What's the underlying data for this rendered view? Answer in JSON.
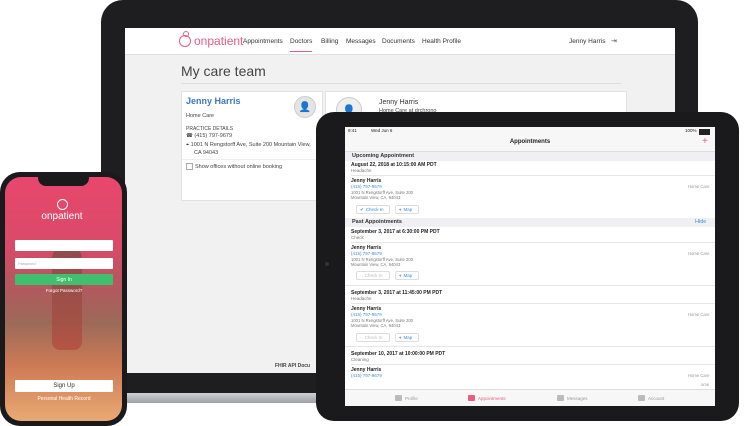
{
  "brand": {
    "name": "onpatient",
    "color": "#e95d83"
  },
  "laptop": {
    "nav": {
      "links": [
        "Appointments",
        "Doctors",
        "Billing",
        "Messages",
        "Documents",
        "Health Profile"
      ],
      "active": "Doctors",
      "user": "Jenny Harris"
    },
    "page_title": "My care team",
    "card1": {
      "name": "Jenny Harris",
      "type": "Home Care",
      "details_heading": "PRACTICE DETAILS",
      "phone": "(415) 797-9679",
      "address_line1": "1001 N Rengstorff Ave, Suite 200 Mountain View,",
      "address_line2": "CA 94043",
      "checkbox_label": "Show offices without online booking"
    },
    "card2": {
      "name": "Jenny Harris",
      "type": "Home Care at drchrono"
    },
    "footer_text": "FHIR API Docu"
  },
  "tablet": {
    "status_time": "9:41",
    "status_date": "Wed Jun 6",
    "status_battery": "100%",
    "title": "Appointments",
    "add_icon": "+",
    "upcoming_heading": "Upcoming Appointment",
    "past_heading": "Past Appointments",
    "hide_label": "Hide",
    "appointments": [
      {
        "date": "August 22, 2018 at 10:15:00 AM PDT",
        "reason": "Headache",
        "name": "Jenny Harris",
        "phone": "(415) 797-9679",
        "addr1": "1001 N Rengstorff Ave, Suite 200",
        "addr2": "Mountain View, CA, 94043",
        "type": "Home Care",
        "checkin": "Check In",
        "map": "Map"
      },
      {
        "date": "September 3, 2017 at 6:30:00 PM PDT",
        "reason": "Check",
        "name": "Jenny Harris",
        "phone": "(415) 797-9679",
        "addr1": "1001 N Rengstorff Ave, Suite 200",
        "addr2": "Mountain View, CA, 94043",
        "type": "Home Care",
        "checkin": "Check In",
        "map": "Map"
      },
      {
        "date": "September 3, 2017 at 11:45:00 PM PDT",
        "reason": "Headache",
        "name": "Jenny Harris",
        "phone": "(415) 797-9679",
        "addr1": "1001 N Rengstorff Ave, Suite 200",
        "addr2": "Mountain View, CA, 94043",
        "type": "Home Care",
        "checkin": "Check In",
        "map": "Map"
      },
      {
        "date": "September 10, 2017 at 10:00:00 PM PDT",
        "reason": "Cleaning",
        "name": "Jenny Harris",
        "phone": "(415) 797-9679",
        "type": "Home Care",
        "extra": "ome"
      }
    ],
    "tabs": [
      "Profile",
      "Appointments",
      "Messages",
      "Account"
    ],
    "active_tab": "Appointments"
  },
  "phone": {
    "brand": "onpatient",
    "password_placeholder": "Password",
    "signin": "Sign In",
    "forgot": "Forgot Password?",
    "signup": "Sign Up",
    "health_record": "Personal Health Record"
  }
}
